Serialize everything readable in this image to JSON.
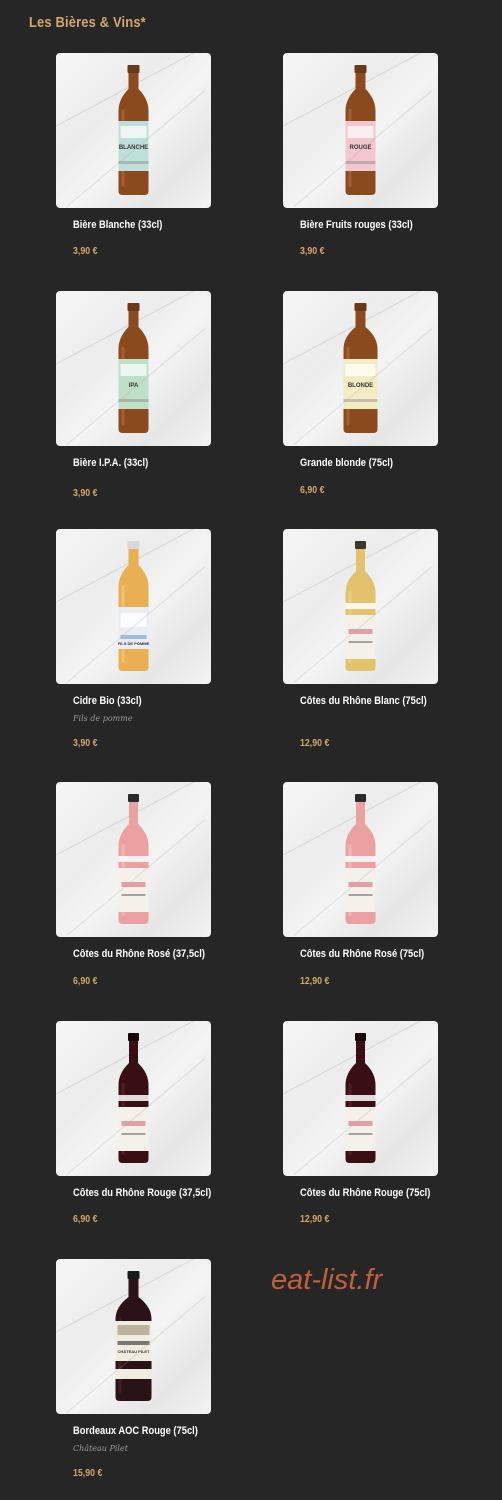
{
  "section": {
    "title": "Les Bières & Vins*"
  },
  "items": [
    {
      "name": "Bière Blanche (33cl)",
      "subtitle": "",
      "price": "3,90 €",
      "label": "BLANCHE",
      "bottle": "beer",
      "label_color": "#bfe0da"
    },
    {
      "name": "Bière Fruits rouges (33cl)",
      "subtitle": "",
      "price": "3,90 €",
      "label": "ROUGE",
      "bottle": "beer",
      "label_color": "#f2c7cf"
    },
    {
      "name": "Bière I.P.A. (33cl)",
      "subtitle": "",
      "price": "3,90 €",
      "label": "IPA",
      "bottle": "beer",
      "label_color": "#bfe0c8"
    },
    {
      "name": "Grande blonde (75cl)",
      "subtitle": "",
      "price": "6,90 €",
      "label": "BLONDE",
      "bottle": "beer-large",
      "label_color": "#f3ecc4"
    },
    {
      "name": "Cidre Bio (33cl)",
      "subtitle": "Fils de pomme",
      "price": "3,90 €",
      "label": "FILS DE POMME",
      "bottle": "cider",
      "label_color": "#e8eef4"
    },
    {
      "name": "Côtes du Rhône Blanc (75cl)",
      "subtitle": "",
      "price": "12,90 €",
      "label": "",
      "bottle": "wine-white",
      "label_color": "#f4f1ea"
    },
    {
      "name": "Côtes du Rhône Rosé (37,5cl)",
      "subtitle": "",
      "price": "6,90 €",
      "label": "",
      "bottle": "wine-rose",
      "label_color": "#f4f1ea"
    },
    {
      "name": "Côtes du Rhône Rosé (75cl)",
      "subtitle": "",
      "price": "12,90 €",
      "label": "",
      "bottle": "wine-rose",
      "label_color": "#f4f1ea"
    },
    {
      "name": "Côtes du Rhône Rouge (37,5cl)",
      "subtitle": "",
      "price": "6,90 €",
      "label": "",
      "bottle": "wine-red",
      "label_color": "#f4f1ea"
    },
    {
      "name": "Côtes du Rhône Rouge (75cl)",
      "subtitle": "",
      "price": "12,90 €",
      "label": "",
      "bottle": "wine-red",
      "label_color": "#f4f1ea"
    },
    {
      "name": "Bordeaux AOC Rouge (75cl)",
      "subtitle": "Château Pilet",
      "price": "15,90 €",
      "label": "CHÂTEAU PILET",
      "bottle": "bordeaux",
      "label_color": "#f1ece0"
    }
  ],
  "watermark": "eat-list.fr",
  "colors": {
    "background": "#262626",
    "accent": "#d4a76a",
    "watermark": "#c0603a"
  }
}
